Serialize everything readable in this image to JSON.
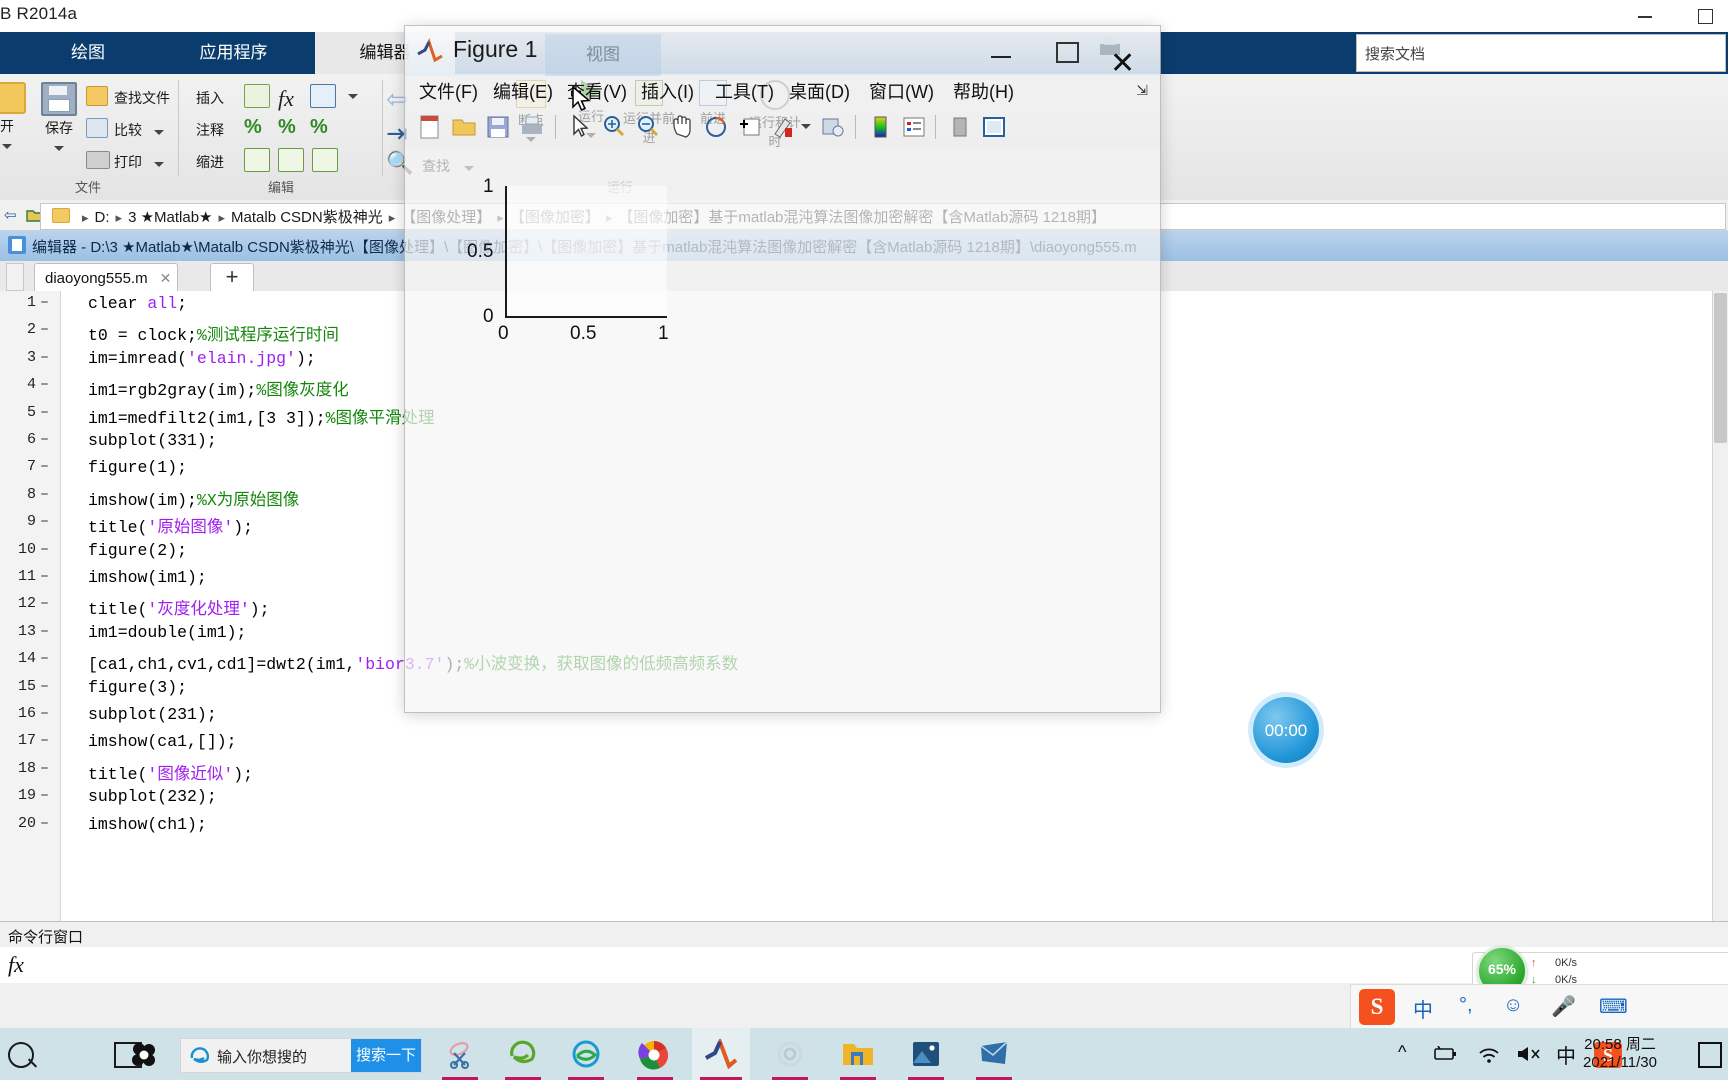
{
  "os": {
    "window_title": "B R2014a",
    "minimize": "minimize-icon",
    "maximize": "maximize-icon"
  },
  "ribbon": {
    "tabs": [
      {
        "label": "绘图",
        "selected": false
      },
      {
        "label": "应用程序",
        "selected": false
      },
      {
        "label": "编辑器",
        "selected": true
      }
    ],
    "search_docs_placeholder": "搜索文档",
    "groups": [
      {
        "label": "文件"
      },
      {
        "label": "编辑"
      }
    ],
    "file_group": {
      "open_label": "开",
      "save_label": "保存",
      "find_files": "查找文件",
      "compare": "比较",
      "print": "打印"
    },
    "edit_group": {
      "insert": "插入",
      "comment": "注释",
      "indent": "缩进"
    },
    "nav_group": {
      "find": "查找"
    },
    "run_group": {
      "breakpoints": "断点",
      "run": "运行",
      "run_advance": "运行并前进",
      "advance": "前进",
      "run_time": "运行和计时",
      "run_label": "运行"
    }
  },
  "address_bar": {
    "crumbs": [
      "D:",
      "3 ★Matlab★",
      "Matalb CSDN紫极神光",
      "【图像处理】",
      "【图像加密】",
      "【图像加密】基于matlab混沌算法图像加密解密【含Matlab源码 1218期】"
    ],
    "separator": "▸"
  },
  "editor": {
    "title": "编辑器 - D:\\3 ★Matlab★\\Matalb CSDN紫极神光\\【图像处理】\\【图像加密】\\【图像加密】基于matlab混沌算法图像加密解密【含Matlab源码 1218期】\\diaoyong555.m",
    "tab_name": "diaoyong555.m",
    "tab_close": "✕",
    "new_tab": "+",
    "lines": [
      {
        "n": "1",
        "text": "clear all;"
      },
      {
        "n": "2",
        "text": "t0 = clock;%测试程序运行时间"
      },
      {
        "n": "3",
        "text": "im=imread('elain.jpg');"
      },
      {
        "n": "4",
        "text": "im1=rgb2gray(im);%图像灰度化"
      },
      {
        "n": "5",
        "text": "im1=medfilt2(im1,[3 3]);%图像平滑处理"
      },
      {
        "n": "6",
        "text": "subplot(331);"
      },
      {
        "n": "7",
        "text": "figure(1);"
      },
      {
        "n": "8",
        "text": "imshow(im);%X为原始图像"
      },
      {
        "n": "9",
        "text": "title('原始图像');"
      },
      {
        "n": "10",
        "text": "figure(2);"
      },
      {
        "n": "11",
        "text": "imshow(im1);"
      },
      {
        "n": "12",
        "text": "title('灰度化处理');"
      },
      {
        "n": "13",
        "text": "im1=double(im1);"
      },
      {
        "n": "14",
        "text": "[ca1,ch1,cv1,cd1]=dwt2(im1,'bior3.7');%小波变换，获取图像的低频高频系数"
      },
      {
        "n": "15",
        "text": "figure(3);"
      },
      {
        "n": "16",
        "text": "subplot(231);"
      },
      {
        "n": "17",
        "text": "imshow(ca1,[]);"
      },
      {
        "n": "18",
        "text": "title('图像近似');"
      },
      {
        "n": "19",
        "text": "subplot(232);"
      },
      {
        "n": "20",
        "text": "imshow(ch1);"
      }
    ]
  },
  "command_window": {
    "title": "命令行窗口",
    "prompt_icon": "fx",
    "input_value": ""
  },
  "figure_window": {
    "title": "Figure 1",
    "ghost_tab": "视图",
    "menus": [
      "文件(F)",
      "编辑(E)",
      "查看(V)",
      "插入(I)",
      "工具(T)",
      "桌面(D)",
      "窗口(W)",
      "帮助(H)"
    ],
    "minimize": "minimize-icon",
    "restore": "restore-icon",
    "close": "✕",
    "overflow": "⇲"
  },
  "chart_data": {
    "type": "line",
    "title": "",
    "xlabel": "",
    "ylabel": "",
    "x": [],
    "y": [],
    "series": [],
    "xticks": [
      "0",
      "0.5",
      "1"
    ],
    "yticks": [
      "0",
      "0.5",
      "1"
    ],
    "xlim": [
      0,
      1
    ],
    "ylim": [
      0,
      1
    ],
    "grid": false,
    "legend": "none",
    "note": "Empty MATLAB axes, default 0-1 range on both axes"
  },
  "timer": {
    "value": "00:00"
  },
  "network_widget": {
    "cpu_percent": "65%",
    "up_speed": "0K/s",
    "down_speed": "0K/s",
    "up_arrow": "↑",
    "down_arrow": "↓"
  },
  "ime_bar": {
    "logo": "S",
    "items": [
      "中",
      "°,",
      "☺",
      "🎤",
      "⌨"
    ]
  },
  "taskbar": {
    "search_icon": "search-icon",
    "taskview_icon": "task-view-icon",
    "ie_search_placeholder": "输入你想搜的",
    "ie_search_button": "搜索一下",
    "apps": [
      {
        "name": "sogou-explorer",
        "running": false
      },
      {
        "name": "snipaste",
        "running": true
      },
      {
        "name": "internet-explorer",
        "running": true
      },
      {
        "name": "microsoft-edge",
        "running": true
      },
      {
        "name": "chrome-like",
        "running": true
      },
      {
        "name": "matlab",
        "running": true,
        "active": true
      },
      {
        "name": "wechat",
        "running": true
      },
      {
        "name": "file-explorer",
        "running": true
      },
      {
        "name": "photos",
        "running": true
      },
      {
        "name": "mail",
        "running": true
      }
    ],
    "tray": {
      "chevron": "^",
      "battery": "battery-icon",
      "wifi": "wifi-icon",
      "volume": "volume-muted-icon",
      "ime_lang": "中",
      "sogou": "S",
      "time": "20:58 周二",
      "date": "2021/11/30",
      "notifications": "notification-icon"
    }
  }
}
